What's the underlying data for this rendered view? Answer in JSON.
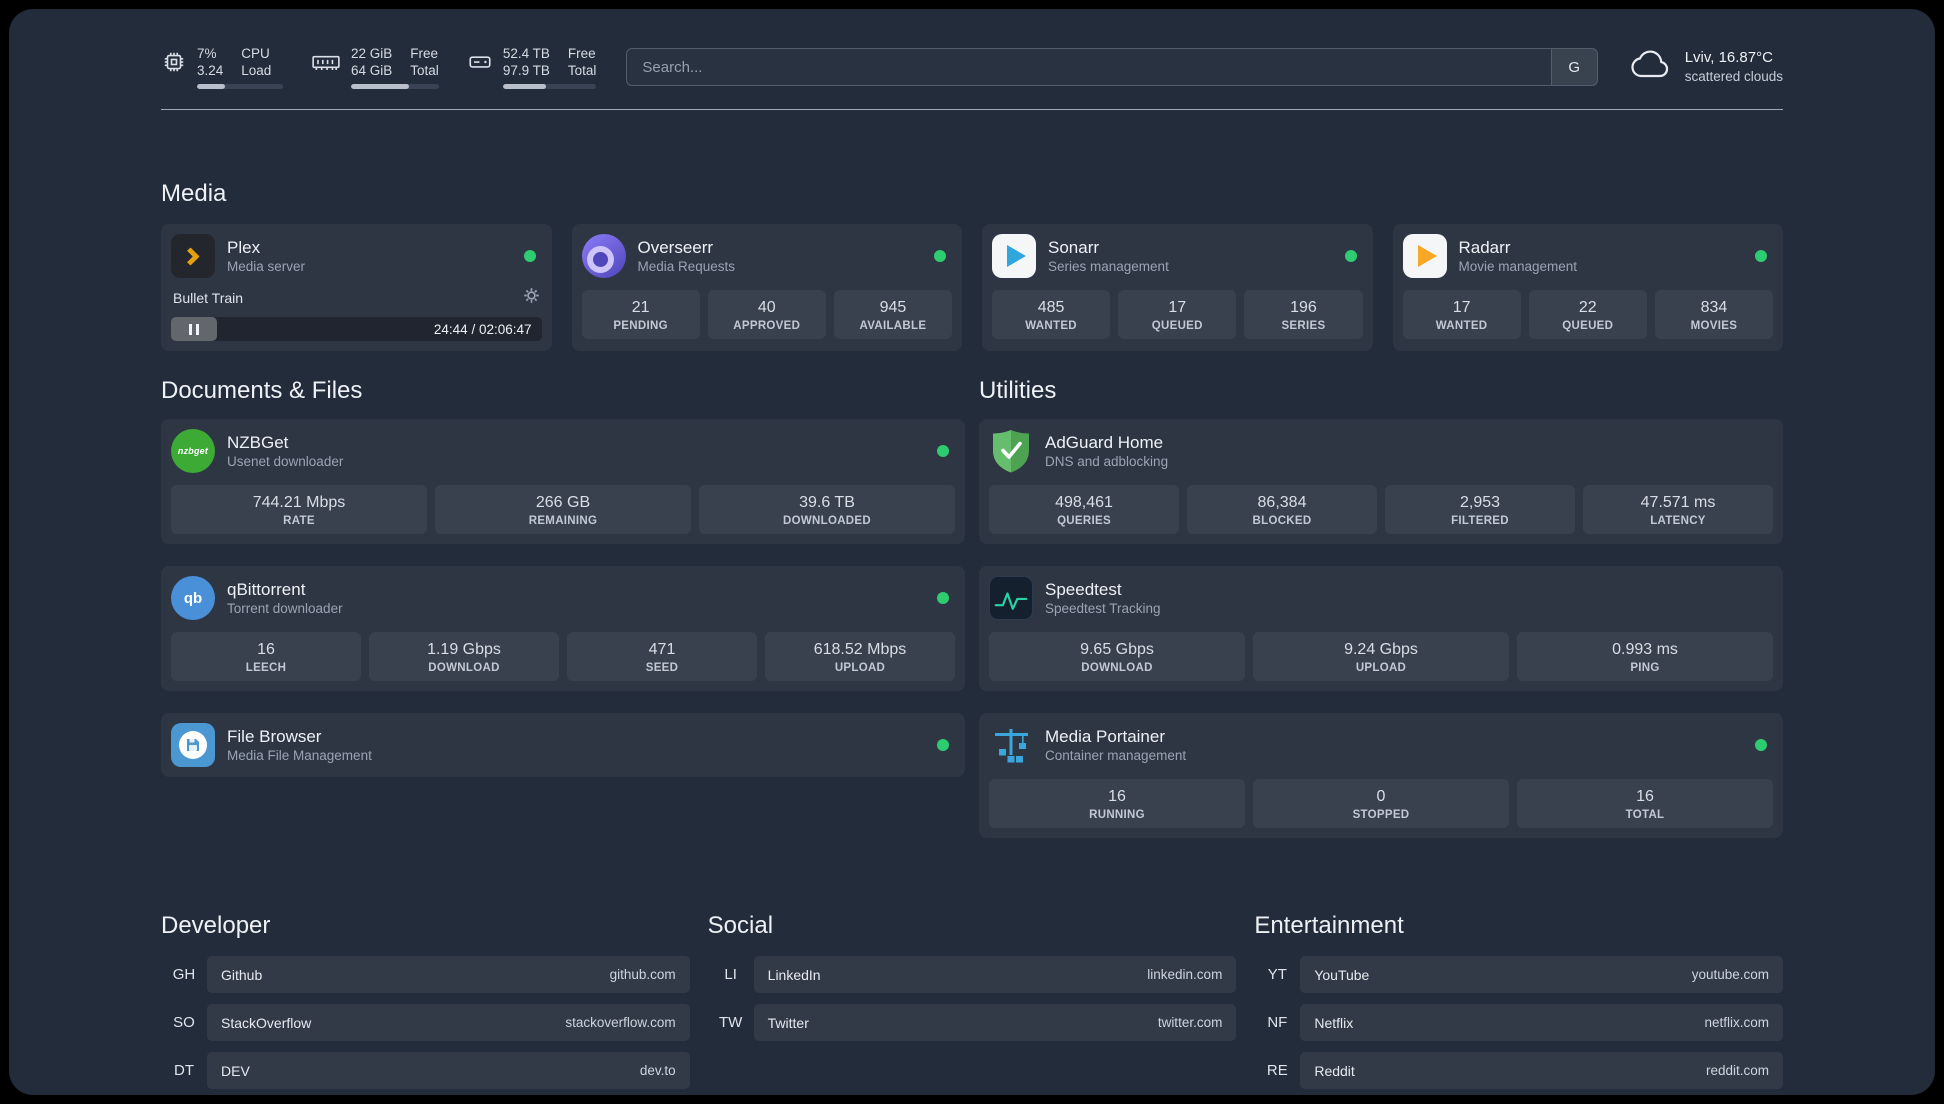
{
  "colors": {
    "status_online": "#2ecc71",
    "accent_plex": "#e5a00d",
    "accent_green": "#2ad3a4"
  },
  "topbar": {
    "cpu": {
      "value": "7%",
      "sub": "3.24",
      "label_top": "CPU",
      "label_bottom": "Load",
      "used_percent": 32
    },
    "ram": {
      "value": "22 GiB",
      "sub": "64 GiB",
      "label_top": "Free",
      "label_bottom": "Total",
      "used_percent": 66
    },
    "disk": {
      "value": "52.4 TB",
      "sub": "97.9 TB",
      "label_top": "Free",
      "label_bottom": "Total",
      "used_percent": 46
    },
    "search": {
      "placeholder": "Search...",
      "provider": "G"
    },
    "weather": {
      "location": "Lviv, 16.87°C",
      "condition": "scattered clouds"
    }
  },
  "media": {
    "title": "Media",
    "cards": [
      {
        "name": "Plex",
        "desc": "Media server",
        "player": {
          "title": "Bullet Train",
          "time": "24:44 / 02:06:47"
        }
      },
      {
        "name": "Overseerr",
        "desc": "Media Requests",
        "stats": [
          {
            "v": "21",
            "l": "PENDING"
          },
          {
            "v": "40",
            "l": "APPROVED"
          },
          {
            "v": "945",
            "l": "AVAILABLE"
          }
        ]
      },
      {
        "name": "Sonarr",
        "desc": "Series management",
        "stats": [
          {
            "v": "485",
            "l": "WANTED"
          },
          {
            "v": "17",
            "l": "QUEUED"
          },
          {
            "v": "196",
            "l": "SERIES"
          }
        ]
      },
      {
        "name": "Radarr",
        "desc": "Movie management",
        "stats": [
          {
            "v": "17",
            "l": "WANTED"
          },
          {
            "v": "22",
            "l": "QUEUED"
          },
          {
            "v": "834",
            "l": "MOVIES"
          }
        ]
      }
    ]
  },
  "documents": {
    "title": "Documents & Files",
    "cards": [
      {
        "name": "NZBGet",
        "desc": "Usenet downloader",
        "stats": [
          {
            "v": "744.21 Mbps",
            "l": "RATE"
          },
          {
            "v": "266 GB",
            "l": "REMAINING"
          },
          {
            "v": "39.6 TB",
            "l": "DOWNLOADED"
          }
        ]
      },
      {
        "name": "qBittorrent",
        "desc": "Torrent downloader",
        "stats": [
          {
            "v": "16",
            "l": "LEECH"
          },
          {
            "v": "1.19 Gbps",
            "l": "DOWNLOAD"
          },
          {
            "v": "471",
            "l": "SEED"
          },
          {
            "v": "618.52 Mbps",
            "l": "UPLOAD"
          }
        ]
      },
      {
        "name": "File Browser",
        "desc": "Media File Management",
        "stats": []
      }
    ]
  },
  "utilities": {
    "title": "Utilities",
    "cards": [
      {
        "name": "AdGuard Home",
        "desc": "DNS and adblocking",
        "stats": [
          {
            "v": "498,461",
            "l": "QUERIES"
          },
          {
            "v": "86,384",
            "l": "BLOCKED"
          },
          {
            "v": "2,953",
            "l": "FILTERED"
          },
          {
            "v": "47.571 ms",
            "l": "LATENCY"
          }
        ]
      },
      {
        "name": "Speedtest",
        "desc": "Speedtest Tracking",
        "stats": [
          {
            "v": "9.65 Gbps",
            "l": "DOWNLOAD"
          },
          {
            "v": "9.24 Gbps",
            "l": "UPLOAD"
          },
          {
            "v": "0.993 ms",
            "l": "PING"
          }
        ]
      },
      {
        "name": "Media Portainer",
        "desc": "Container management",
        "stats": [
          {
            "v": "16",
            "l": "RUNNING"
          },
          {
            "v": "0",
            "l": "STOPPED"
          },
          {
            "v": "16",
            "l": "TOTAL"
          }
        ]
      }
    ]
  },
  "bookmarks": {
    "groups": [
      {
        "title": "Developer",
        "items": [
          {
            "abbr": "GH",
            "name": "Github",
            "url": "github.com"
          },
          {
            "abbr": "SO",
            "name": "StackOverflow",
            "url": "stackoverflow.com"
          },
          {
            "abbr": "DT",
            "name": "DEV",
            "url": "dev.to"
          }
        ]
      },
      {
        "title": "Social",
        "items": [
          {
            "abbr": "LI",
            "name": "LinkedIn",
            "url": "linkedin.com"
          },
          {
            "abbr": "TW",
            "name": "Twitter",
            "url": "twitter.com"
          }
        ]
      },
      {
        "title": "Entertainment",
        "items": [
          {
            "abbr": "YT",
            "name": "YouTube",
            "url": "youtube.com"
          },
          {
            "abbr": "NF",
            "name": "Netflix",
            "url": "netflix.com"
          },
          {
            "abbr": "RE",
            "name": "Reddit",
            "url": "reddit.com"
          }
        ]
      }
    ]
  }
}
